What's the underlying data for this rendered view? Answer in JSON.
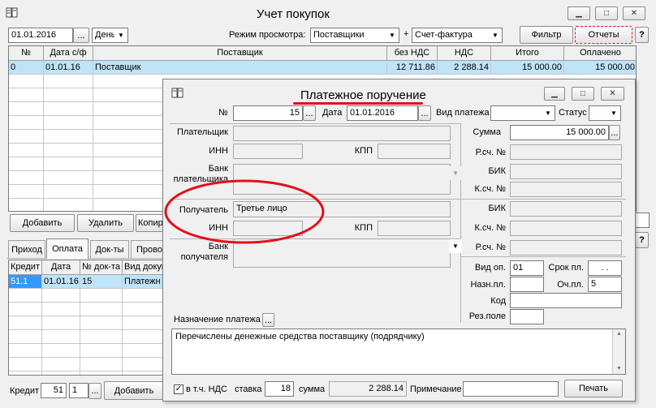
{
  "main": {
    "title": "Учет покупок",
    "date": "01.01.2016",
    "date_btn": "...",
    "period": "День",
    "view_mode_label": "Режим просмотра:",
    "view_mode": "Поставщики",
    "plus": "+",
    "invoice_type": "Счет-фактура",
    "filter_btn": "Фильтр",
    "reports_btn": "Отчеты",
    "help": "?",
    "columns": [
      "№",
      "Дата с/ф",
      "Поставщик",
      "без НДС",
      "НДС",
      "Итого",
      "Оплачено"
    ],
    "row": [
      "0",
      "01.01.16",
      "Поставщик",
      "12 711.86",
      "2 288.14",
      "15 000.00",
      "15 000.00"
    ],
    "add_btn": "Добавить",
    "delete_btn": "Удалить",
    "copy_btn": "Копир",
    "tabs": [
      "Приход",
      "Оплата",
      "Док-ты",
      "Прово"
    ],
    "sub_columns": [
      "Кредит",
      "Дата",
      "№ док-та",
      "Вид докум"
    ],
    "sub_row": [
      "51.1",
      "01.01.16",
      "15",
      "Платежн"
    ],
    "credit_label": "Кредит",
    "credit_acc": "51",
    "credit_sub": "1",
    "credit_btn": "...",
    "add_btn2": "Добавить",
    "right_field": "",
    "right_help": "?"
  },
  "dialog": {
    "title": "Платежное поручение",
    "num_label": "№",
    "num": "15",
    "date_label": "Дата",
    "date": "01.01.2016",
    "pay_type_label": "Вид платежа",
    "pay_type": "",
    "status_label": "Статус",
    "status": "",
    "payer_label": "Плательщик",
    "payer": "",
    "inn_label": "ИНН",
    "kpp_label": "КПП",
    "payer_inn": "",
    "payer_kpp": "",
    "payer_bank_label": "Банк плательщика",
    "payer_bank": "",
    "sum_label": "Сумма",
    "sum": "15 000.00",
    "rs_label": "Р.сч. №",
    "bik_label": "БИК",
    "ks_label": "К.сч. №",
    "recipient_label": "Получатель",
    "recipient": "Третье лицо",
    "rec_inn": "",
    "rec_kpp": "",
    "rec_bank_label": "Банк получателя",
    "rec_bank": "",
    "op_type_label": "Вид оп.",
    "op_type": "01",
    "term_label": "Срок пл.",
    "term": ". .",
    "purpose_code_label": "Назн.пл.",
    "purpose_code": "",
    "order_label": "Оч.пл.",
    "order": "5",
    "code_label": "Код",
    "code": "",
    "res_label": "Рез.поле",
    "res": "",
    "purpose_label": "Назначение платежа",
    "purpose_btn": "...",
    "purpose_text": "Перечислены денежные средства поставщику (подрядчику)",
    "vat_label": "в т.ч. НДС",
    "vat_checked": true,
    "rate_label": "ставка",
    "rate": "18",
    "sum2_label": "сумма",
    "vat_sum": "2 288.14",
    "note_label": "Примечание",
    "note": "",
    "print_btn": "Печать"
  },
  "colors": {
    "highlight": "#e3101a",
    "selection": "#bfe3f9"
  }
}
